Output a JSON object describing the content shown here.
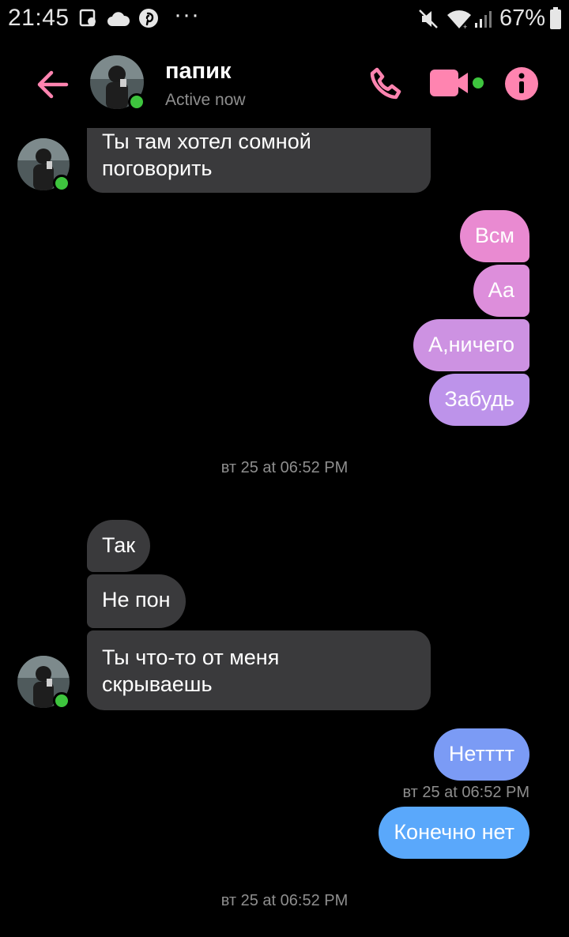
{
  "status_bar": {
    "time": "21:45",
    "battery": "67%",
    "more": "···"
  },
  "header": {
    "back_icon": "arrow-left-icon",
    "contact_name": "папик",
    "contact_status": "Active now",
    "accent_color": "#ff84b0"
  },
  "messages": [
    {
      "side": "in",
      "text": "Ты там хотел сомной\nпоговорить"
    },
    {
      "side": "out",
      "text": "Всм"
    },
    {
      "side": "out",
      "text": "Аа"
    },
    {
      "side": "out",
      "text": "А,ничего"
    },
    {
      "side": "out",
      "text": "Забудь"
    },
    {
      "side": "in",
      "text": "Так"
    },
    {
      "side": "in",
      "text": "Не пон"
    },
    {
      "side": "in",
      "text": "Ты что-то от меня\nскрываешь"
    },
    {
      "side": "out",
      "text": "Нетттт"
    },
    {
      "side": "out",
      "text": "Конечно нет"
    }
  ],
  "timestamps": {
    "t1": "вт 25 at 06:52 PM",
    "t2": "вт 25 at 06:52 PM",
    "t3": "вт 25 at 06:52 PM"
  }
}
